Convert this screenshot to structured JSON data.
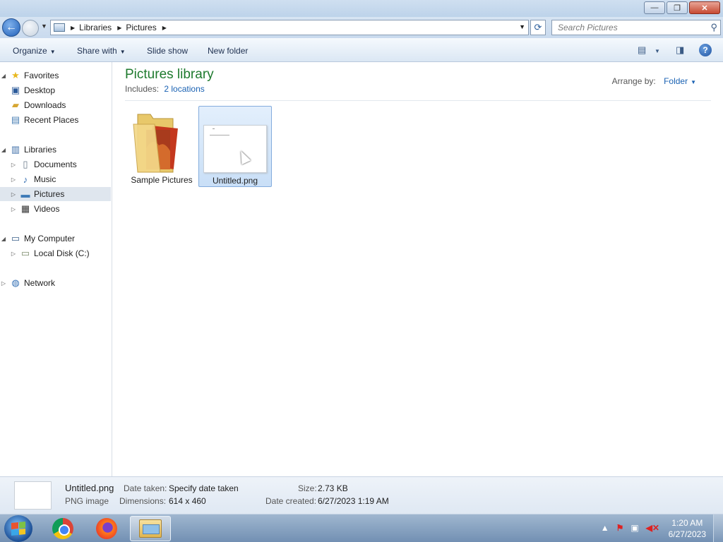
{
  "window": {
    "minimize": "—",
    "restore": "❐",
    "close": "✕"
  },
  "address": {
    "crumbs": [
      "Libraries",
      "Pictures"
    ],
    "search_placeholder": "Search Pictures"
  },
  "toolbar": {
    "organize": "Organize",
    "share_with": "Share with",
    "slide_show": "Slide show",
    "new_folder": "New folder",
    "help": "?"
  },
  "nav": {
    "favorites": "Favorites",
    "desktop": "Desktop",
    "downloads": "Downloads",
    "recent_places": "Recent Places",
    "libraries": "Libraries",
    "documents": "Documents",
    "music": "Music",
    "pictures": "Pictures",
    "videos": "Videos",
    "my_computer": "My Computer",
    "local_disk": "Local Disk (C:)",
    "network": "Network"
  },
  "content": {
    "title": "Pictures library",
    "includes_label": "Includes:",
    "includes_link": "2 locations",
    "arrange_label": "Arrange by:",
    "arrange_value": "Folder",
    "items": [
      {
        "name": "Sample Pictures",
        "type": "folder",
        "selected": false
      },
      {
        "name": "Untitled.png",
        "type": "image",
        "selected": true
      }
    ]
  },
  "details": {
    "file_name": "Untitled.png",
    "file_type": "PNG image",
    "date_taken_label": "Date taken:",
    "date_taken_value": "Specify date taken",
    "dimensions_label": "Dimensions:",
    "dimensions_value": "614 x 460",
    "size_label": "Size:",
    "size_value": "2.73 KB",
    "date_created_label": "Date created:",
    "date_created_value": "6/27/2023 1:19 AM"
  },
  "taskbar": {
    "time": "1:20 AM",
    "date": "6/27/2023"
  },
  "colors": {
    "title_green": "#1e7a2e",
    "link_blue": "#1a62b3",
    "selection": "#c9dff7"
  }
}
